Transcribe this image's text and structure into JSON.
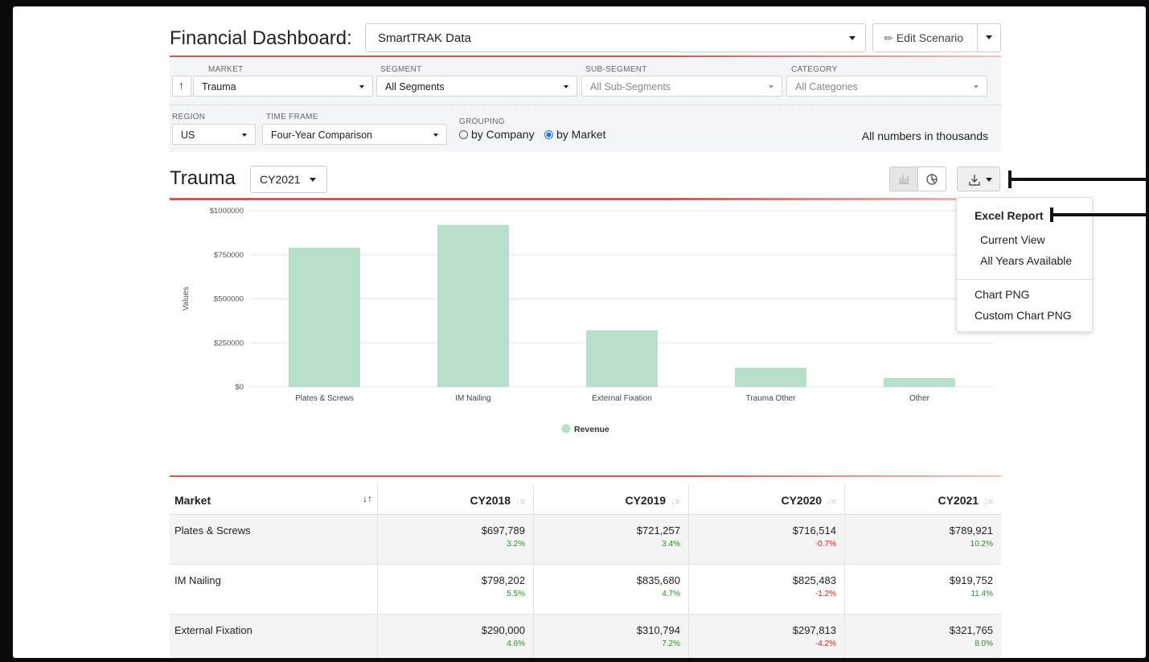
{
  "header": {
    "title": "Financial Dashboard:",
    "scenario": "SmartTRAK Data",
    "edit_label": "Edit Scenario"
  },
  "filters": {
    "market": {
      "label": "MARKET",
      "value": "Trauma"
    },
    "segment": {
      "label": "SEGMENT",
      "value": "All Segments"
    },
    "subsegment": {
      "label": "SUB-SEGMENT",
      "value": "All Sub-Segments"
    },
    "category": {
      "label": "CATEGORY",
      "value": "All Categories"
    },
    "region": {
      "label": "REGION",
      "value": "US"
    },
    "timeframe": {
      "label": "TIME FRAME",
      "value": "Four-Year Comparison"
    },
    "grouping": {
      "label": "GROUPING",
      "by_company": "by Company",
      "by_market": "by Market",
      "selected": "by Market"
    },
    "note": "All numbers in thousands"
  },
  "section": {
    "title": "Trauma",
    "year": "CY2021"
  },
  "export_menu": {
    "header": "Excel Report",
    "items": [
      "Current View",
      "All Years Available",
      "Chart PNG",
      "Custom Chart PNG"
    ]
  },
  "chart_data": {
    "type": "bar",
    "categories": [
      "Plates & Screws",
      "IM Nailing",
      "External Fixation",
      "Trauma Other",
      "Other"
    ],
    "series": [
      {
        "name": "Revenue",
        "values": [
          789921,
          919752,
          321765,
          108000,
          50000
        ],
        "color": "#b7dfc9"
      }
    ],
    "ylabel": "Values",
    "xlabel": "",
    "ylim": [
      0,
      1000000
    ],
    "yticks": [
      "$0",
      "$250000",
      "$500000",
      "$750000",
      "$1000000"
    ],
    "grid": true,
    "legend": "bottom-center"
  },
  "table": {
    "columns": [
      "Market",
      "CY2018",
      "CY2019",
      "CY2020",
      "CY2021"
    ],
    "rows": [
      {
        "market": "Plates & Screws",
        "values": [
          "$697,789",
          "$721,257",
          "$716,514",
          "$789,921"
        ],
        "pcts": [
          "3.2%",
          "3.4%",
          "-0.7%",
          "10.2%"
        ]
      },
      {
        "market": "IM Nailing",
        "values": [
          "$798,202",
          "$835,680",
          "$825,483",
          "$919,752"
        ],
        "pcts": [
          "5.5%",
          "4.7%",
          "-1.2%",
          "11.4%"
        ]
      },
      {
        "market": "External Fixation",
        "values": [
          "$290,000",
          "$310,794",
          "$297,813",
          "$321,765"
        ],
        "pcts": [
          "4.6%",
          "7.2%",
          "-4.2%",
          "8.0%"
        ]
      }
    ]
  },
  "colors": {
    "accent": "#d9534f",
    "bar": "#b7dfc9",
    "positive": "#2e8b2e",
    "negative": "#e01b1b"
  }
}
